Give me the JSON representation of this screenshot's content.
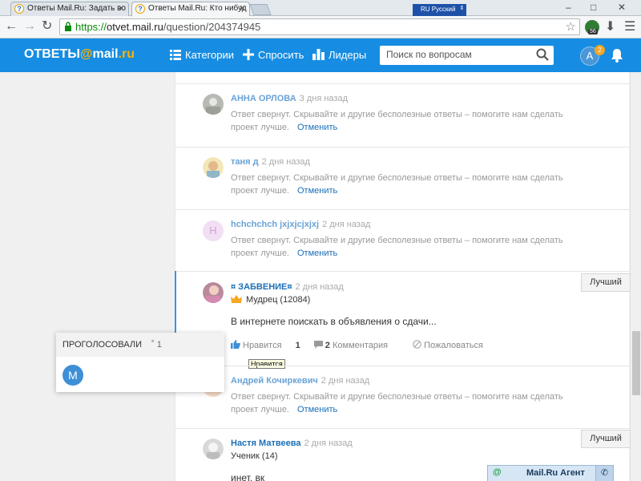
{
  "browser": {
    "tabs": [
      {
        "title": "Ответы Mail.Ru: Задать во",
        "active": false
      },
      {
        "title": "Ответы Mail.Ru: Кто нибуд",
        "active": true
      }
    ],
    "language_indicator": "RU Русский",
    "url_scheme": "https://",
    "url_host": "otvet.mail.ru",
    "url_path": "/question/204374945",
    "extension_badge": "56"
  },
  "header": {
    "logo_text": "ответы",
    "logo_at": "@",
    "logo_brand": "mail",
    "logo_suffix": ".ru",
    "nav": {
      "categories": "Категории",
      "ask": "Спросить",
      "leaders": "Лидеры"
    },
    "search_placeholder": "Поиск по вопросам",
    "user_initial": "А",
    "notification_count": "2"
  },
  "answers": [
    {
      "name": "АННА ОРЛОВА",
      "time": "3 дня назад",
      "collapsed_text": "Ответ свернут. Скрывайте и другие бесполезные ответы – помогите нам сделать проект лучше.",
      "cancel": "Отменить"
    },
    {
      "name": "таня д",
      "time": "2 дня назад",
      "collapsed_text": "Ответ свернут. Скрывайте и другие бесполезные ответы – помогите нам сделать проект лучше.",
      "cancel": "Отменить"
    },
    {
      "name": "hchchchch jxjxjcjxjxj",
      "time": "2 дня назад",
      "avatar_initial": "H",
      "collapsed_text": "Ответ свернут. Скрывайте и другие бесполезные ответы – помогите нам сделать проект лучше.",
      "cancel": "Отменить"
    }
  ],
  "featured_answer": {
    "name": "¤ ЗАБВЕНИЕ¤",
    "time": "2 дня назад",
    "rank": "Мудрец (12084)",
    "text": "В интернете поискать в объявления о сдачи...",
    "likes_label": "Нравится",
    "likes_count": "1",
    "comments_count": "2",
    "comments_label": "Комментария",
    "report_label": "Пожаловаться",
    "best_label": "Лучший",
    "tooltip": "Нравится"
  },
  "answer_after": {
    "name": "Андрей Кочиркевич",
    "time": "2 дня назад",
    "collapsed_text": "Ответ свернут. Скрывайте и другие бесполезные ответы – помогите нам сделать проект лучше.",
    "cancel": "Отменить"
  },
  "answer_last": {
    "name": "Настя Матвеева",
    "time": "2 дня назад",
    "rank": "Ученик (14)",
    "text": "инет, вк",
    "best_label": "Лучший"
  },
  "votes_popup": {
    "title": "ПРОГОЛОСОВАЛИ",
    "count": "1",
    "voter_initial": "М"
  },
  "agent": {
    "label": "Mail.Ru Агент"
  },
  "colors": {
    "header_blue": "#168de2",
    "logo_accent": "#ffb100",
    "link_blue": "#1a6fb8",
    "name_light_blue": "#6aa3d6"
  }
}
